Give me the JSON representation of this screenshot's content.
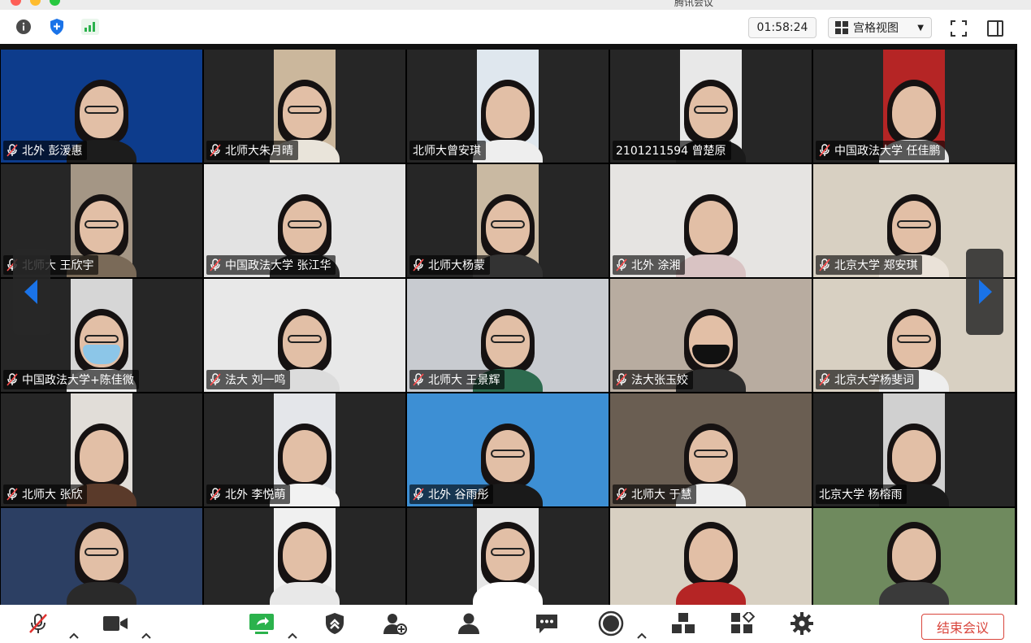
{
  "window": {
    "title": "腾讯会议"
  },
  "toolbar": {
    "timer": "01:58:24",
    "view_label": "宫格视图",
    "icons": [
      "info-icon",
      "shield-icon",
      "signal-icon",
      "fullscreen-icon",
      "side-panel-icon"
    ]
  },
  "gallery": {
    "tiles": [
      {
        "name": "北外 彭湲惠",
        "muted": true,
        "bg": "#0d3c8c",
        "shirt": "#1c1c1c",
        "glasses": true,
        "mask": ""
      },
      {
        "name": "北师大朱月晴",
        "muted": true,
        "bg": "#cbb79c",
        "shirt": "#e9e4da",
        "glasses": true,
        "mask": ""
      },
      {
        "name": "北师大曾安琪",
        "muted": false,
        "bg": "#dfe7ee",
        "shirt": "#eeeeee",
        "glasses": false,
        "mask": ""
      },
      {
        "name": "2101211594 曾楚原",
        "muted": false,
        "bg": "#e8e8e8",
        "shirt": "#1a1a1a",
        "glasses": true,
        "mask": ""
      },
      {
        "name": "中国政法大学  任佳鹏",
        "muted": true,
        "bg": "#b52525",
        "shirt": "#e6e6e6",
        "glasses": false,
        "mask": ""
      },
      {
        "name": "北师大 王欣宇",
        "muted": true,
        "bg": "#a49685",
        "shirt": "#7a6a58",
        "glasses": true,
        "mask": ""
      },
      {
        "name": "中国政法大学 张江华",
        "muted": true,
        "bg": "#e3e3e3",
        "shirt": "#2c2c2c",
        "glasses": true,
        "mask": ""
      },
      {
        "name": "北师大杨蒙",
        "muted": true,
        "bg": "#c9b9a2",
        "shirt": "#333333",
        "glasses": true,
        "mask": ""
      },
      {
        "name": "北外 涂湘",
        "muted": true,
        "bg": "#e6e4e2",
        "shirt": "#d9c3c3",
        "glasses": false,
        "mask": ""
      },
      {
        "name": "北京大学 郑安琪",
        "muted": true,
        "bg": "#d8d0c2",
        "shirt": "#eae2d8",
        "glasses": true,
        "mask": ""
      },
      {
        "name": "中国政法大学+陈佳微",
        "muted": true,
        "bg": "#d6d6d6",
        "shirt": "#eeeeee",
        "glasses": true,
        "mask": "#8cc6e8"
      },
      {
        "name": "法大 刘一鸣",
        "muted": true,
        "bg": "#e8e8e8",
        "shirt": "#dcdcdc",
        "glasses": true,
        "mask": ""
      },
      {
        "name": "北师大 王景辉",
        "muted": true,
        "bg": "#c8cbd0",
        "shirt": "#2d6b4f",
        "glasses": true,
        "mask": ""
      },
      {
        "name": "法大张玉姣",
        "muted": true,
        "bg": "#b8aca0",
        "shirt": "#2c2c2c",
        "glasses": false,
        "mask": "#111111"
      },
      {
        "name": "北京大学杨斐词",
        "muted": true,
        "bg": "#d8d0c2",
        "shirt": "#eeeeee",
        "glasses": true,
        "mask": ""
      },
      {
        "name": "北师大 张欣",
        "muted": true,
        "bg": "#e1ddd8",
        "shirt": "#5a3a2a",
        "glasses": false,
        "mask": ""
      },
      {
        "name": "北外 李悦萌",
        "muted": true,
        "bg": "#e4e6ea",
        "shirt": "#f2f2f2",
        "glasses": false,
        "mask": ""
      },
      {
        "name": "北外 谷雨彤",
        "muted": true,
        "bg": "#3d8fd4",
        "shirt": "#1a1a1a",
        "glasses": true,
        "mask": ""
      },
      {
        "name": "北师大 于慧",
        "muted": true,
        "bg": "#6a5e52",
        "shirt": "#eeeeee",
        "glasses": true,
        "mask": ""
      },
      {
        "name": "北京大学 杨榕雨",
        "muted": false,
        "bg": "#d0d0d0",
        "shirt": "#1a1a1a",
        "glasses": false,
        "mask": ""
      },
      {
        "name": "",
        "muted": false,
        "bg": "#2c3f63",
        "shirt": "#2a2a2a",
        "glasses": true,
        "mask": ""
      },
      {
        "name": "",
        "muted": false,
        "bg": "#f0f0f0",
        "shirt": "#e8e8e8",
        "glasses": false,
        "mask": ""
      },
      {
        "name": "",
        "muted": false,
        "bg": "#e6e6e6",
        "shirt": "#ffffff",
        "glasses": true,
        "mask": ""
      },
      {
        "name": "",
        "muted": false,
        "bg": "#d8d0c2",
        "shirt": "#b52525",
        "glasses": false,
        "mask": ""
      },
      {
        "name": "",
        "muted": false,
        "bg": "#6f8a5e",
        "shirt": "#3a3a3a",
        "glasses": false,
        "mask": ""
      }
    ]
  },
  "bottombar": {
    "icons": [
      "microphone-muted-icon",
      "camera-icon",
      "share-screen-icon",
      "security-icon",
      "invite-icon",
      "participants-icon",
      "chat-icon",
      "record-icon",
      "apps-icon",
      "app-store-icon",
      "settings-icon"
    ],
    "end_label": "结束会议"
  },
  "colors": {
    "accent": "#1a73e8",
    "share": "#2bb24c",
    "end": "#d9453c"
  }
}
